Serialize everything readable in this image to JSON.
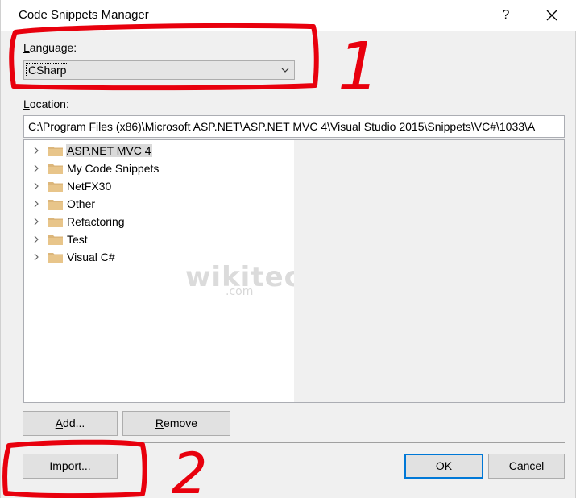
{
  "window": {
    "title": "Code Snippets Manager",
    "help_glyph": "?",
    "close_icon": "close-icon"
  },
  "language": {
    "label_underlined": "L",
    "label_rest": "anguage:",
    "selected_value": "CSharp"
  },
  "location": {
    "label_underlined": "L",
    "label_rest": "ocation:",
    "path": "C:\\Program Files (x86)\\Microsoft ASP.NET\\ASP.NET MVC 4\\Visual Studio 2015\\Snippets\\VC#\\1033\\A"
  },
  "tree": {
    "items": [
      {
        "label": "ASP.NET MVC 4",
        "selected": true
      },
      {
        "label": "My Code Snippets",
        "selected": false
      },
      {
        "label": "NetFX30",
        "selected": false
      },
      {
        "label": "Other",
        "selected": false
      },
      {
        "label": "Refactoring",
        "selected": false
      },
      {
        "label": "Test",
        "selected": false
      },
      {
        "label": "Visual C#",
        "selected": false
      }
    ]
  },
  "watermark": {
    "text": "wikitechy",
    "sub": ".com"
  },
  "buttons": {
    "add": {
      "underlined": "A",
      "rest": "dd..."
    },
    "remove": {
      "underlined": "R",
      "rest": "emove"
    },
    "import": {
      "underlined": "I",
      "rest": "mport..."
    },
    "ok": "OK",
    "cancel": "Cancel"
  },
  "annotations": {
    "marker_1": "1",
    "marker_2": "2",
    "color": "#e8000d"
  },
  "colors": {
    "dialog_bg": "#f0f0f0",
    "default_button_border": "#0078d7",
    "selection_bg": "#d9d9d9",
    "folder": "#dcb67a"
  }
}
